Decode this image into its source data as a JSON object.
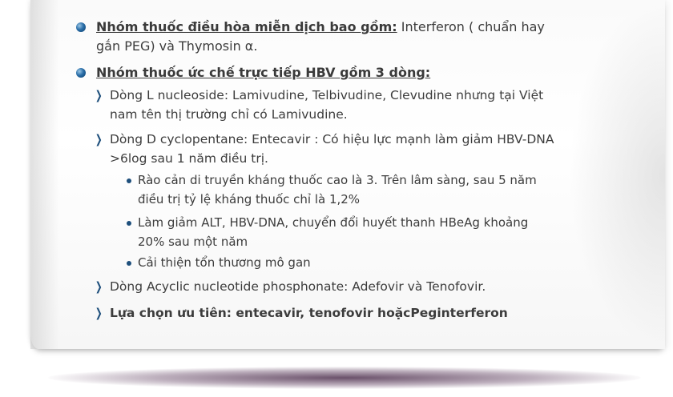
{
  "items": [
    {
      "head": "Nhóm thuốc điều hòa miễn dịch bao gồm:",
      "rest": " Interferon ( chuẩn hay gắn PEG) và Thymosin α."
    },
    {
      "head": "Nhóm thuốc ức chế trực tiếp HBV gồm 3 dòng:",
      "subitems": [
        {
          "text": "Dòng L nucleoside: Lamivudine, Telbivudine, Clevudine nhưng tại Việt nam tên thị trường chỉ có Lamivudine."
        },
        {
          "text": "Dòng D cyclopentane: Entecavir : Có hiệu lực mạnh làm giảm HBV-DNA >6log sau 1 năm điều trị.",
          "bullets": [
            "Rào cản di truyền kháng thuốc cao là 3. Trên lâm sàng, sau 5 năm điều trị tỷ lệ kháng thuốc chỉ là 1,2%",
            "Làm giảm ALT, HBV-DNA, chuyển đổi huyết thanh HBeAg khoảng 20% sau một năm",
            "Cải thiện tổn thương mô gan"
          ]
        },
        {
          "text": "Dòng Acyclic nucleotide phosphonate: Adefovir và Tenofovir."
        }
      ]
    }
  ],
  "conclusion": "Lựa chọn ưu tiên: entecavir, tenofovir hoặcPeginterferon",
  "colors": {
    "bullet": "#1e4f7c",
    "text": "#3c3c3c"
  },
  "icons": {
    "level1": "blue-sphere-bullet-icon",
    "level2": "chevron-right-icon",
    "level3": "small-dot-bullet-icon"
  }
}
